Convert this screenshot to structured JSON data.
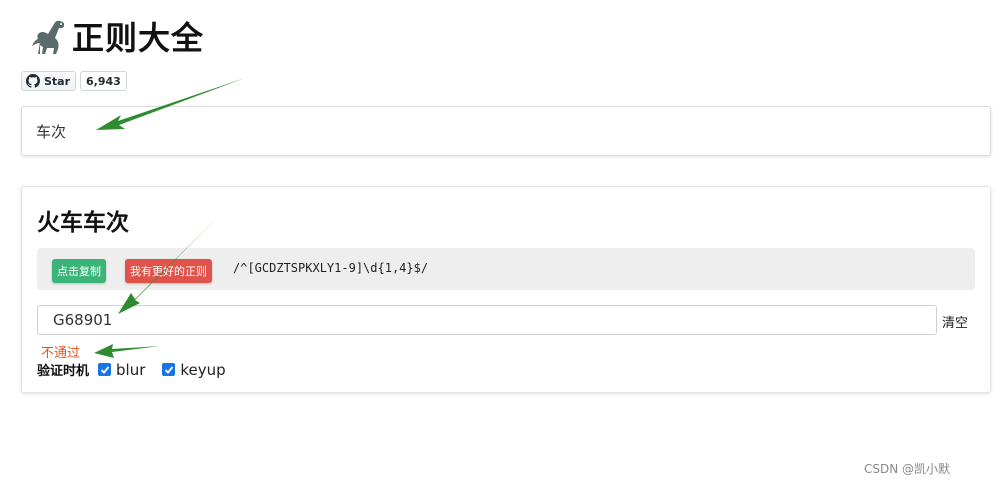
{
  "header": {
    "title": "正则大全",
    "logo_icon": "dinosaur-icon"
  },
  "github": {
    "star_label": "Star",
    "star_count": "6,943",
    "icon": "github-icon"
  },
  "search": {
    "value": "车次"
  },
  "card": {
    "title": "火车车次",
    "copy_label": "点击复制",
    "better_label": "我有更好的正则",
    "regex": "/^[GCDZTSPKXLY1-9]\\d{1,4}$/",
    "test_value": "G68901",
    "clear_label": "清空",
    "result": "不通过",
    "timing_label": "验证时机",
    "options": [
      {
        "label": "blur",
        "checked": true
      },
      {
        "label": "keyup",
        "checked": true
      }
    ]
  },
  "watermark": "CSDN @凯小默",
  "colors": {
    "copy_button": "#3bb47a",
    "better_button": "#e0534a",
    "result_fail": "#e8541e",
    "annotation_arrow": "#2e8b2e",
    "checkbox": "#1a73e8"
  }
}
